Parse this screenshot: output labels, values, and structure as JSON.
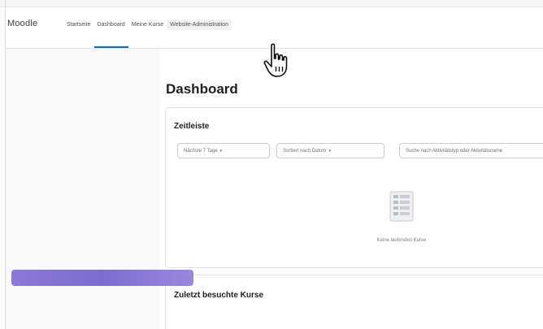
{
  "navbar": {
    "brand": "Moodle",
    "links": [
      {
        "label": "Startseite"
      },
      {
        "label": "Dashboard"
      },
      {
        "label": "Meine Kurse"
      },
      {
        "label": "Website-Administration"
      }
    ],
    "active_index": 1,
    "hover_index": 3
  },
  "main": {
    "page_title": "Dashboard",
    "timeline": {
      "title": "Zeitleiste",
      "filter_days": "Nächste 7 Tage",
      "filter_sort": "Sortiert nach Datum",
      "search_placeholder": "Suche nach Aktivitätstyp oder Aktivitätsname",
      "empty_text": "Keine laufenden Kurse"
    },
    "recent": {
      "title": "Zuletzt besuchte Kurse"
    }
  },
  "icons": {
    "cursor": "hand-pointer-icon",
    "empty_state": "list-placeholder-icon",
    "dropdown": "caret-down-icon"
  },
  "colors": {
    "accent": "#0f6cbf",
    "course_tile": "#8c79d6"
  }
}
